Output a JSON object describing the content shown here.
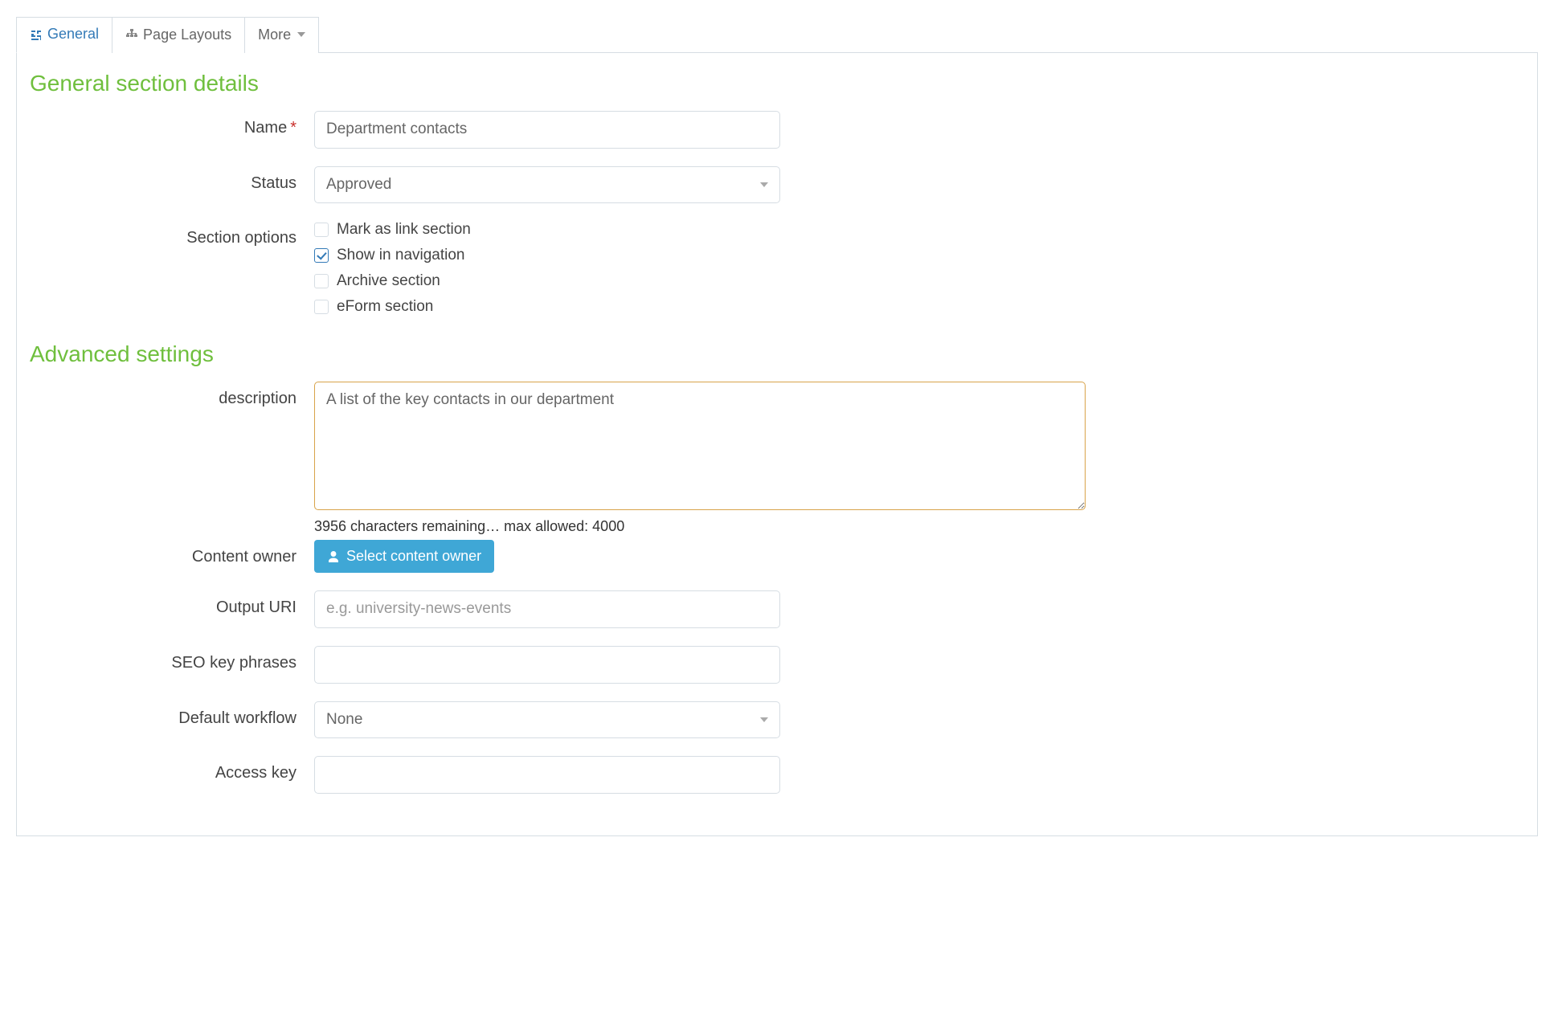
{
  "tabs": {
    "general": "General",
    "page_layouts": "Page Layouts",
    "more": "More"
  },
  "general_section": {
    "heading": "General section details",
    "name_label": "Name",
    "name_value": "Department contacts",
    "status_label": "Status",
    "status_value": "Approved",
    "options_label": "Section options",
    "options": {
      "link_section": {
        "label": "Mark as link section",
        "checked": false
      },
      "show_nav": {
        "label": "Show in navigation",
        "checked": true
      },
      "archive": {
        "label": "Archive section",
        "checked": false
      },
      "eform": {
        "label": "eForm section",
        "checked": false
      }
    }
  },
  "advanced": {
    "heading": "Advanced settings",
    "description_label": "description",
    "description_value": "A list of the key contacts in our department",
    "char_remaining": "3956 characters remaining… max allowed: 4000",
    "content_owner_label": "Content owner",
    "content_owner_btn": "Select content owner",
    "output_uri_label": "Output URI",
    "output_uri_placeholder": "e.g. university-news-events",
    "seo_label": "SEO key phrases",
    "workflow_label": "Default workflow",
    "workflow_value": "None",
    "access_key_label": "Access key"
  }
}
